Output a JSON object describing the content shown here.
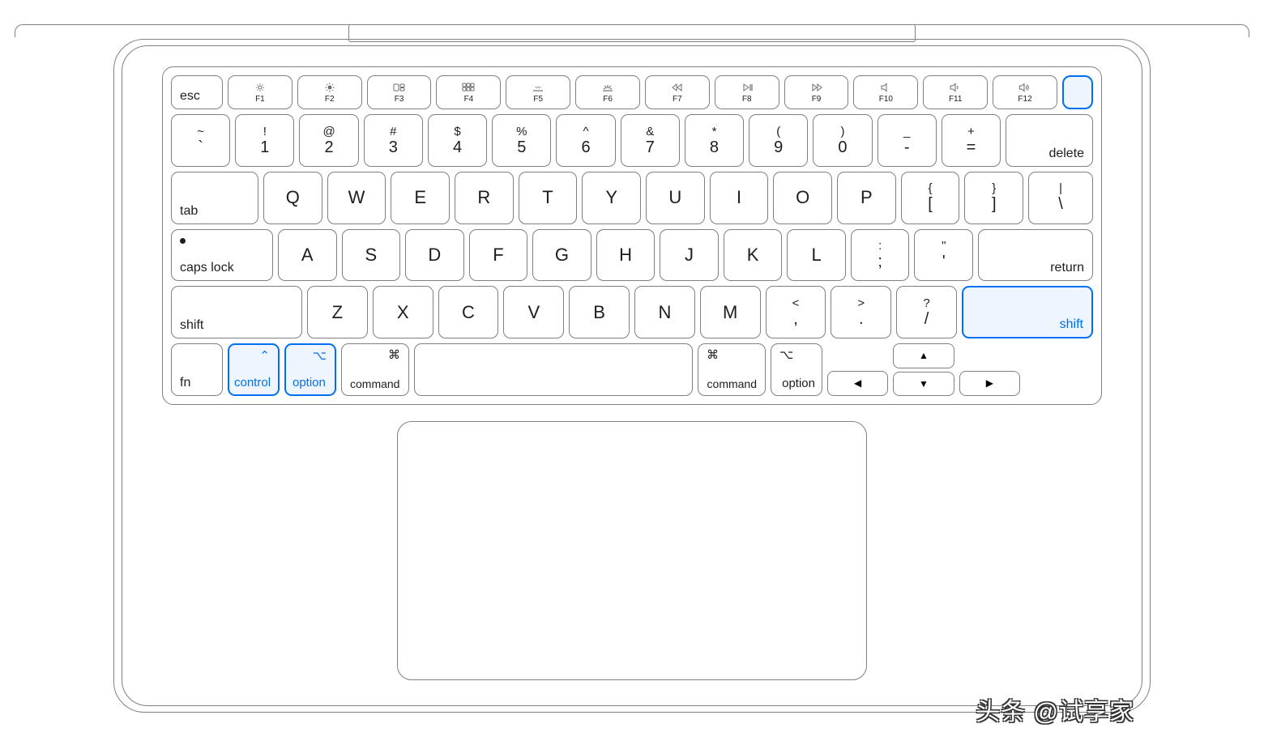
{
  "watermark": "头条 @试享家",
  "highlighted_keys": [
    "touchid",
    "right-shift",
    "control",
    "left-option"
  ],
  "keyboard": {
    "fn_row": [
      {
        "id": "esc",
        "label": "esc",
        "icon": null
      },
      {
        "id": "f1",
        "label": "F1",
        "icon": "brightness-down"
      },
      {
        "id": "f2",
        "label": "F2",
        "icon": "brightness-up"
      },
      {
        "id": "f3",
        "label": "F3",
        "icon": "mission-control"
      },
      {
        "id": "f4",
        "label": "F4",
        "icon": "launchpad"
      },
      {
        "id": "f5",
        "label": "F5",
        "icon": "keyboard-dim"
      },
      {
        "id": "f6",
        "label": "F6",
        "icon": "keyboard-bright"
      },
      {
        "id": "f7",
        "label": "F7",
        "icon": "rewind"
      },
      {
        "id": "f8",
        "label": "F8",
        "icon": "play-pause"
      },
      {
        "id": "f9",
        "label": "F9",
        "icon": "forward"
      },
      {
        "id": "f10",
        "label": "F10",
        "icon": "mute"
      },
      {
        "id": "f11",
        "label": "F11",
        "icon": "volume-down"
      },
      {
        "id": "f12",
        "label": "F12",
        "icon": "volume-up"
      },
      {
        "id": "touchid",
        "label": "",
        "icon": null
      }
    ],
    "number_row": [
      {
        "id": "grave",
        "top": "~",
        "bot": "`"
      },
      {
        "id": "1",
        "top": "!",
        "bot": "1"
      },
      {
        "id": "2",
        "top": "@",
        "bot": "2"
      },
      {
        "id": "3",
        "top": "#",
        "bot": "3"
      },
      {
        "id": "4",
        "top": "$",
        "bot": "4"
      },
      {
        "id": "5",
        "top": "%",
        "bot": "5"
      },
      {
        "id": "6",
        "top": "^",
        "bot": "6"
      },
      {
        "id": "7",
        "top": "&",
        "bot": "7"
      },
      {
        "id": "8",
        "top": "*",
        "bot": "8"
      },
      {
        "id": "9",
        "top": "(",
        "bot": "9"
      },
      {
        "id": "0",
        "top": ")",
        "bot": "0"
      },
      {
        "id": "minus",
        "top": "_",
        "bot": "-"
      },
      {
        "id": "equals",
        "top": "+",
        "bot": "="
      },
      {
        "id": "delete",
        "label": "delete"
      }
    ],
    "qwerty_row": [
      {
        "id": "tab",
        "label": "tab"
      },
      {
        "id": "q",
        "label": "Q"
      },
      {
        "id": "w",
        "label": "W"
      },
      {
        "id": "e",
        "label": "E"
      },
      {
        "id": "r",
        "label": "R"
      },
      {
        "id": "t",
        "label": "T"
      },
      {
        "id": "y",
        "label": "Y"
      },
      {
        "id": "u",
        "label": "U"
      },
      {
        "id": "i",
        "label": "I"
      },
      {
        "id": "o",
        "label": "O"
      },
      {
        "id": "p",
        "label": "P"
      },
      {
        "id": "lbrack",
        "top": "{",
        "bot": "["
      },
      {
        "id": "rbrack",
        "top": "}",
        "bot": "]"
      },
      {
        "id": "bslash",
        "top": "|",
        "bot": "\\"
      }
    ],
    "home_row": [
      {
        "id": "caps",
        "label": "caps lock"
      },
      {
        "id": "a",
        "label": "A"
      },
      {
        "id": "s",
        "label": "S"
      },
      {
        "id": "d",
        "label": "D"
      },
      {
        "id": "f",
        "label": "F"
      },
      {
        "id": "g",
        "label": "G"
      },
      {
        "id": "h",
        "label": "H"
      },
      {
        "id": "j",
        "label": "J"
      },
      {
        "id": "k",
        "label": "K"
      },
      {
        "id": "l",
        "label": "L"
      },
      {
        "id": "semi",
        "top": ":",
        "bot": ";"
      },
      {
        "id": "quote",
        "top": "\"",
        "bot": "'"
      },
      {
        "id": "return",
        "label": "return"
      }
    ],
    "shift_row": [
      {
        "id": "lshift",
        "label": "shift"
      },
      {
        "id": "z",
        "label": "Z"
      },
      {
        "id": "x",
        "label": "X"
      },
      {
        "id": "c",
        "label": "C"
      },
      {
        "id": "v",
        "label": "V"
      },
      {
        "id": "b",
        "label": "B"
      },
      {
        "id": "n",
        "label": "N"
      },
      {
        "id": "m",
        "label": "M"
      },
      {
        "id": "comma",
        "top": "<",
        "bot": ","
      },
      {
        "id": "period",
        "top": ">",
        "bot": "."
      },
      {
        "id": "slash",
        "top": "?",
        "bot": "/"
      },
      {
        "id": "rshift",
        "label": "shift"
      }
    ],
    "bottom_row": [
      {
        "id": "fn",
        "label": "fn",
        "sym": ""
      },
      {
        "id": "control",
        "label": "control",
        "sym": "⌃"
      },
      {
        "id": "loption",
        "label": "option",
        "sym": "⌥"
      },
      {
        "id": "lcommand",
        "label": "command",
        "sym": "⌘"
      },
      {
        "id": "space",
        "label": ""
      },
      {
        "id": "rcommand",
        "label": "command",
        "sym": "⌘"
      },
      {
        "id": "roption",
        "label": "option",
        "sym": "⌥"
      }
    ],
    "arrows": {
      "up": "▲",
      "down": "▼",
      "left": "◀",
      "right": "▶"
    }
  }
}
